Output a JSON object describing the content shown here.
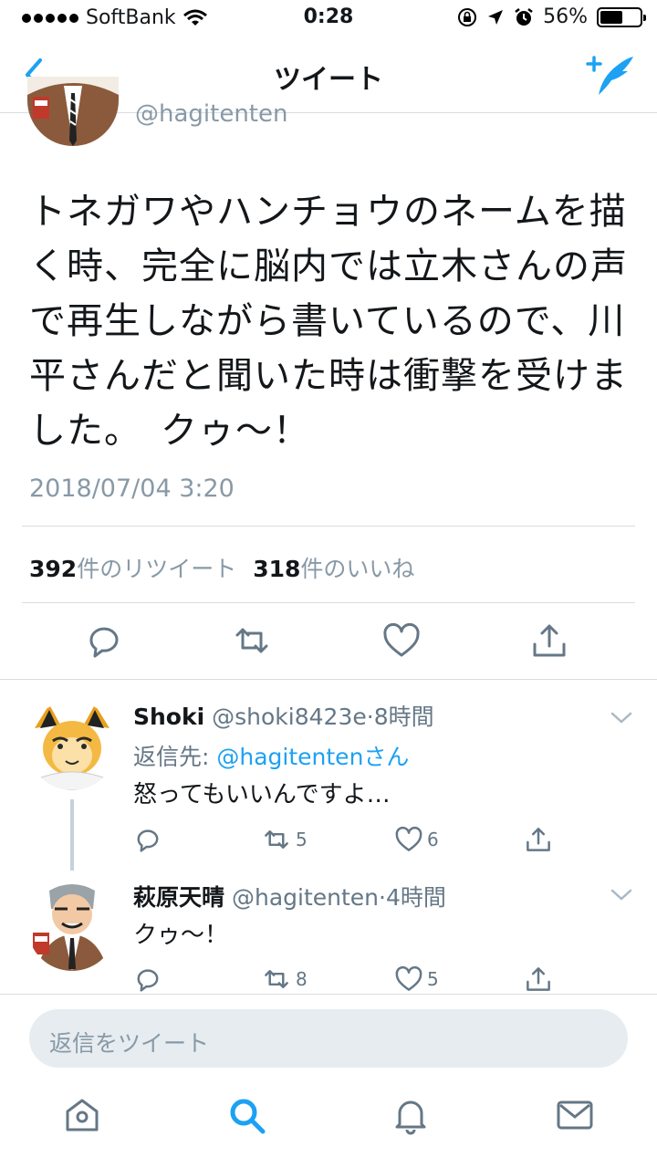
{
  "status_bar": {
    "carrier": "SoftBank",
    "time": "0:28",
    "battery": "56%",
    "battery_level": 0.56
  },
  "nav": {
    "title": "ツイート",
    "back_icon": "chevron-left-icon",
    "compose_icon": "compose-tweet-icon"
  },
  "tweet": {
    "handle": "@hagitenten",
    "text": "トネガワやハンチョウのネームを描く時、完全に脳内では立木さんの声で再生しながら書いているので、川平さんだと聞いた時は衝撃を受けました。　クゥ〜！",
    "timestamp": "2018/07/04 3:20",
    "retweets_count": "392",
    "retweets_label": "件のリツイート",
    "likes_count": "318",
    "likes_label": "件のいいね"
  },
  "replies": [
    {
      "name": "Shoki",
      "handle": "@shoki8423e",
      "time": "8時間",
      "reply_to_prefix": "返信先: ",
      "reply_to_handle": "@hagitentenさん",
      "text": "怒ってもいいんですよ…",
      "retweets": "5",
      "likes": "6"
    },
    {
      "name": "萩原天晴",
      "handle": "@hagitenten",
      "time": "4時間",
      "text": "クゥ〜！",
      "retweets": "8",
      "likes": "5"
    }
  ],
  "reply_box": {
    "placeholder": "返信をツイート"
  },
  "colors": {
    "accent": "#1da1f2",
    "text": "#14171a",
    "muted": "#8899a6",
    "divider": "#d8dde2"
  }
}
